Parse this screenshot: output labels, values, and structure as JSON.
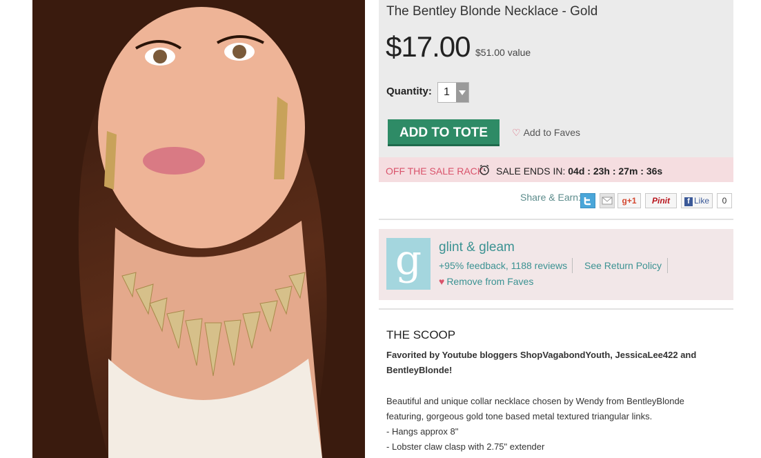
{
  "product": {
    "title": "The Bentley Blonde Necklace - Gold",
    "price": "$17.00",
    "value": "$51.00 value",
    "quantity_label": "Quantity:",
    "quantity": "1",
    "add_to_tote": "ADD TO TOTE",
    "add_to_faves": "Add to Faves"
  },
  "sale": {
    "label": "OFF THE SALE RACK",
    "ends_prefix": "SALE ENDS IN:",
    "countdown": "04d : 23h : 27m : 36s"
  },
  "share": {
    "label": "Share & Earn:",
    "google_plus": "+1",
    "pinterest": "Pinit",
    "facebook": "Like",
    "like_count": "0"
  },
  "seller": {
    "logo_letter": "g",
    "name": "glint & gleam",
    "feedback": "+95% feedback, 1188 reviews",
    "return_policy": "See Return Policy",
    "remove_faves": "Remove from Faves"
  },
  "scoop": {
    "heading": "THE SCOOP",
    "favorited_line1": "Favorited by Youtube bloggers ShopVagabondYouth, JessicaLee422 and",
    "favorited_line2": "BentleyBlonde!",
    "desc_line1": "Beautiful and unique collar necklace chosen by Wendy from BentleyBlonde",
    "desc_line2": "featuring, gorgeous gold tone based metal textured triangular links.",
    "desc_line3": "- Hangs approx 8\"",
    "desc_line4": "- Lobster claw clasp with 2.75\" extender"
  },
  "colors": {
    "brand_green": "#2e8b66",
    "sale_pink": "#d9536b",
    "link_teal": "#3b9292"
  },
  "icons": [
    "heart-icon",
    "alarm-clock-icon",
    "twitter-icon",
    "email-icon",
    "chevron-down-icon"
  ]
}
